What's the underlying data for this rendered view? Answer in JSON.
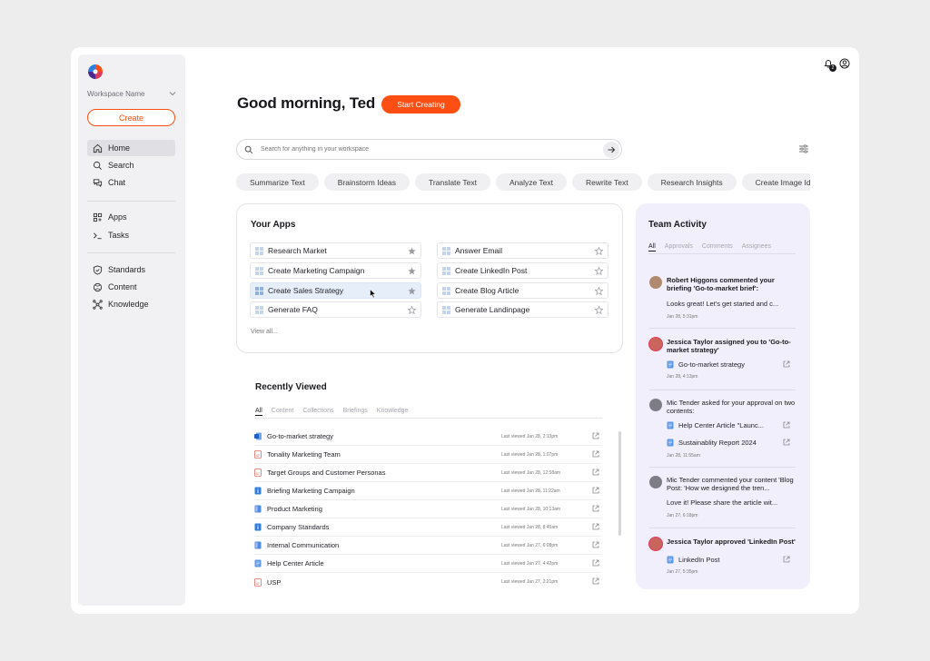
{
  "sidebar": {
    "workspace_name": "Workspace Name",
    "create_label": "Create",
    "items": [
      {
        "label": "Home",
        "icon": "home-icon"
      },
      {
        "label": "Search",
        "icon": "search-icon"
      },
      {
        "label": "Chat",
        "icon": "chat-icon"
      },
      {
        "label": "Apps",
        "icon": "apps-icon"
      },
      {
        "label": "Tasks",
        "icon": "terminal-icon"
      },
      {
        "label": "Standards",
        "icon": "shield-icon"
      },
      {
        "label": "Content",
        "icon": "content-icon"
      },
      {
        "label": "Knowledge",
        "icon": "knowledge-icon"
      }
    ]
  },
  "header": {
    "greeting": "Good morning, Ted",
    "start_label": "Start Creating",
    "notification_count": "2"
  },
  "search": {
    "placeholder": "Search for anything in your workspace"
  },
  "chips": [
    "Summarize Text",
    "Brainstorm Ideas",
    "Translate Text",
    "Analyze Text",
    "Rewrite Text",
    "Research Insights",
    "Create Image Ide"
  ],
  "apps": {
    "title": "Your Apps",
    "view_all": "View all...",
    "items": [
      {
        "label": "Research Market"
      },
      {
        "label": "Answer Email"
      },
      {
        "label": "Create Marketing Campaign"
      },
      {
        "label": "Create LinkedIn Post"
      },
      {
        "label": "Create Sales Strategy"
      },
      {
        "label": "Create Blog Article"
      },
      {
        "label": "Generate FAQ"
      },
      {
        "label": "Generate Landinpage"
      }
    ]
  },
  "recent": {
    "title": "Recently Viewed",
    "tabs": [
      "All",
      "Content",
      "Collections",
      "Briefings",
      "Knowledge"
    ],
    "rows": [
      {
        "name": "Go-to-market strategy",
        "time": "Last viewed Jan 28, 2:13pm"
      },
      {
        "name": "Tonality Marketing Team",
        "time": "Last viewed Jan 28, 1:07pm"
      },
      {
        "name": "Target Groups and Customer Personas",
        "time": "Last viewed Jan 28, 12:58am"
      },
      {
        "name": "Briefing Marketing Campaign",
        "time": "Last viewed Jan 28, 11:22am"
      },
      {
        "name": "Product Marketing",
        "time": "Last viewed Jan 28, 10:13am"
      },
      {
        "name": "Company Standards",
        "time": "Last viewed Jan 28, 8:45am"
      },
      {
        "name": "Internal Communication",
        "time": "Last viewed Jan 27, 6:08pm"
      },
      {
        "name": "Help Center Article",
        "time": "Last viewed Jan 27, 4:42pm"
      },
      {
        "name": "USP",
        "time": "Last viewed Jan 27, 2:21pm"
      }
    ]
  },
  "team": {
    "title": "Team Activity",
    "tabs": [
      "All",
      "Approvals",
      "Comments",
      "Assignees"
    ],
    "activities": [
      {
        "text": "Robert Higgons commented your briefing 'Go-to-market brief':",
        "message": "Looks great! Let's get started and c...",
        "date": "Jan 28, 5:31pm"
      },
      {
        "text": "Jessica Taylor assigned you to 'Go-to-market strategy'",
        "doc": "Go-to-market strategy",
        "date": "Jan 28, 4:13pm"
      },
      {
        "text": "Mic Tender asked for your approval on two contents:",
        "docs": [
          "Help Center Article \"Launc...",
          "Sustainablity Report 2024"
        ],
        "date": "Jan 28, 11:55am"
      },
      {
        "text": "Mic Tender commented your content 'Blog Post: 'How we designed the tren...",
        "message": "Love it! Please share the article wit...",
        "date": "Jan 27, 6:18pm"
      },
      {
        "text": "Jessica Taylor approved 'LinkedIn Post'",
        "doc": "LinkedIn Post",
        "date": "Jan 27, 5:35pm"
      }
    ]
  }
}
